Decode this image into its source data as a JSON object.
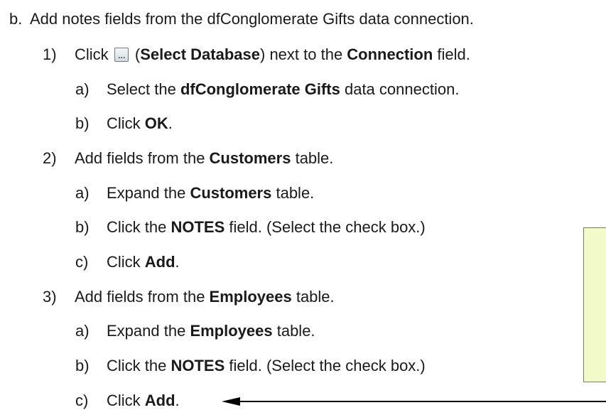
{
  "steps": [
    {
      "marker": "b.",
      "parts": [
        {
          "t": "Add notes fields from the dfConglomerate Gifts data connection.",
          "b": false
        }
      ]
    },
    {
      "marker": "1)",
      "parts": [
        {
          "t": "Click ",
          "b": false
        },
        {
          "icon": "select-database-button-icon",
          "glyph": "..."
        },
        {
          "t": " (",
          "b": false
        },
        {
          "t": "Select Database",
          "b": true
        },
        {
          "t": ") next to the ",
          "b": false
        },
        {
          "t": "Connection",
          "b": true
        },
        {
          "t": " field.",
          "b": false
        }
      ]
    },
    {
      "marker": "a)",
      "parts": [
        {
          "t": "Select the ",
          "b": false
        },
        {
          "t": "dfConglomerate Gifts",
          "b": true
        },
        {
          "t": " data connection.",
          "b": false
        }
      ]
    },
    {
      "marker": "b)",
      "parts": [
        {
          "t": "Click ",
          "b": false
        },
        {
          "t": "OK",
          "b": true
        },
        {
          "t": ".",
          "b": false
        }
      ]
    },
    {
      "marker": "2)",
      "parts": [
        {
          "t": "Add fields from the ",
          "b": false
        },
        {
          "t": "Customers",
          "b": true
        },
        {
          "t": " table.",
          "b": false
        }
      ]
    },
    {
      "marker": "a)",
      "parts": [
        {
          "t": "Expand the ",
          "b": false
        },
        {
          "t": "Customers",
          "b": true
        },
        {
          "t": " table.",
          "b": false
        }
      ]
    },
    {
      "marker": "b)",
      "parts": [
        {
          "t": "Click the ",
          "b": false
        },
        {
          "t": "NOTES",
          "b": true
        },
        {
          "t": " field. (Select the check box.)",
          "b": false
        }
      ]
    },
    {
      "marker": "c)",
      "parts": [
        {
          "t": "Click ",
          "b": false
        },
        {
          "t": "Add",
          "b": true
        },
        {
          "t": ".",
          "b": false
        }
      ]
    },
    {
      "marker": "3)",
      "parts": [
        {
          "t": "Add fields from the ",
          "b": false
        },
        {
          "t": "Employees",
          "b": true
        },
        {
          "t": " table.",
          "b": false
        }
      ]
    },
    {
      "marker": "a)",
      "parts": [
        {
          "t": "Expand the ",
          "b": false
        },
        {
          "t": "Employees",
          "b": true
        },
        {
          "t": " table.",
          "b": false
        }
      ]
    },
    {
      "marker": "b)",
      "parts": [
        {
          "t": "Click the ",
          "b": false
        },
        {
          "t": "NOTES",
          "b": true
        },
        {
          "t": " field. (Select the check box.)",
          "b": false
        }
      ]
    },
    {
      "marker": "c)",
      "parts": [
        {
          "t": "Click ",
          "b": false
        },
        {
          "t": "Add",
          "b": true
        },
        {
          "t": ".",
          "b": false
        }
      ]
    }
  ],
  "colors": {
    "callout_fill": "#f2fac9",
    "callout_border": "#7b7b64",
    "text": "#1a1a1a"
  }
}
